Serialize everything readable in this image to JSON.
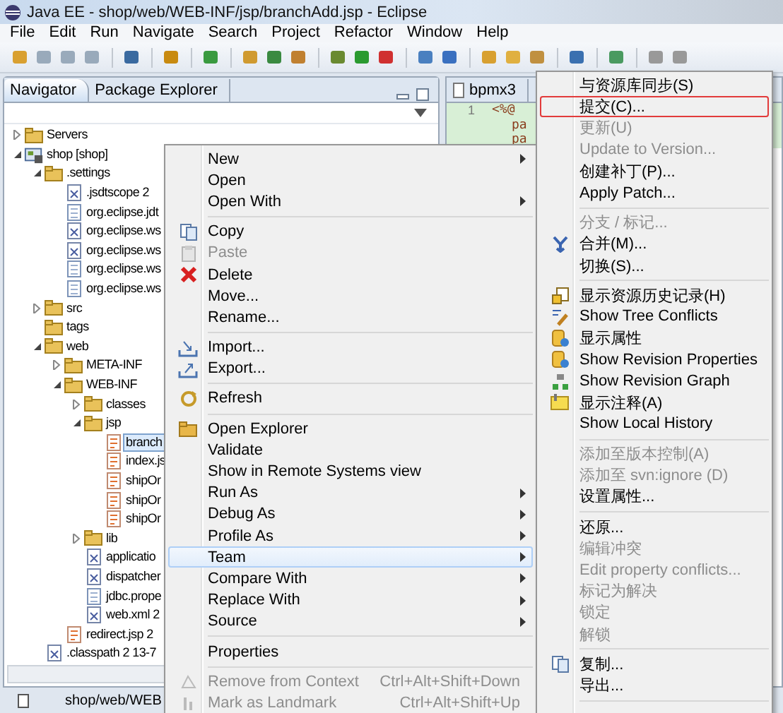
{
  "window": {
    "title": "Java EE - shop/web/WEB-INF/jsp/branchAdd.jsp - Eclipse"
  },
  "menu_bar": [
    "File",
    "Edit",
    "Run",
    "Navigate",
    "Search",
    "Project",
    "Refactor",
    "Window",
    "Help"
  ],
  "navigator": {
    "tabs": [
      {
        "label": "Navigator",
        "selected": true
      },
      {
        "label": "Package Explorer",
        "selected": false
      }
    ],
    "tree": [
      {
        "label": "Servers",
        "kind": "folder",
        "expanded": false,
        "selected": false
      },
      {
        "label": "shop [shop]",
        "kind": "project",
        "expanded": true,
        "selected": false,
        "children": [
          {
            "label": ".settings",
            "kind": "folder",
            "expanded": true,
            "selected": false,
            "children": [
              {
                "label": ".jsdtscope 2",
                "kind": "xml",
                "selected": false
              },
              {
                "label": "org.eclipse.jdt",
                "kind": "file",
                "selected": false
              },
              {
                "label": "org.eclipse.ws",
                "kind": "xml",
                "selected": false
              },
              {
                "label": "org.eclipse.ws",
                "kind": "xml",
                "selected": false
              },
              {
                "label": "org.eclipse.ws",
                "kind": "file",
                "selected": false
              },
              {
                "label": "org.eclipse.ws",
                "kind": "file",
                "selected": false
              }
            ]
          },
          {
            "label": "src",
            "kind": "folder",
            "expanded": false,
            "selected": false
          },
          {
            "label": "tags",
            "kind": "folder",
            "selected": false
          },
          {
            "label": "web",
            "kind": "folder",
            "expanded": true,
            "selected": false,
            "children": [
              {
                "label": "META-INF",
                "kind": "folder",
                "expanded": false,
                "selected": false
              },
              {
                "label": "WEB-INF",
                "kind": "folder",
                "expanded": true,
                "selected": false,
                "children": [
                  {
                    "label": "classes",
                    "kind": "folder",
                    "expanded": false,
                    "selected": false
                  },
                  {
                    "label": "jsp",
                    "kind": "folder",
                    "expanded": true,
                    "selected": false,
                    "children": [
                      {
                        "label": "branch",
                        "kind": "jsp",
                        "selected": true
                      },
                      {
                        "label": "index.js",
                        "kind": "jsp",
                        "selected": false
                      },
                      {
                        "label": "shipOr",
                        "kind": "jsp",
                        "selected": false
                      },
                      {
                        "label": "shipOr",
                        "kind": "jsp",
                        "selected": false
                      },
                      {
                        "label": "shipOr",
                        "kind": "jsp",
                        "selected": false
                      }
                    ]
                  },
                  {
                    "label": "lib",
                    "kind": "folder",
                    "expanded": false,
                    "selected": false
                  },
                  {
                    "label": "applicatio",
                    "kind": "xml",
                    "selected": false
                  },
                  {
                    "label": "dispatcher",
                    "kind": "xml",
                    "selected": false
                  },
                  {
                    "label": "jdbc.prope",
                    "kind": "file",
                    "selected": false
                  },
                  {
                    "label": "web.xml 2",
                    "kind": "xml",
                    "selected": false
                  }
                ]
              },
              {
                "label": "redirect.jsp 2",
                "kind": "jsp",
                "selected": false
              }
            ]
          },
          {
            "label": ".classpath 2  13-7",
            "kind": "xml",
            "selected": false
          }
        ]
      }
    ]
  },
  "editor": {
    "tab": "bpmx3",
    "lines": [
      {
        "number": "1",
        "text": "<%@"
      },
      {
        "text": "pa"
      },
      {
        "text": "pa"
      }
    ]
  },
  "context_menu": [
    {
      "kind": "item",
      "label": "New",
      "submenu": true
    },
    {
      "kind": "item",
      "label": "Open"
    },
    {
      "kind": "item",
      "label": "Open With",
      "submenu": true
    },
    {
      "kind": "separator"
    },
    {
      "kind": "item",
      "label": "Copy"
    },
    {
      "kind": "item",
      "label": "Paste",
      "disabled": true
    },
    {
      "kind": "item",
      "label": "Delete"
    },
    {
      "kind": "item",
      "label": "Move..."
    },
    {
      "kind": "item",
      "label": "Rename..."
    },
    {
      "kind": "separator"
    },
    {
      "kind": "item",
      "label": "Import..."
    },
    {
      "kind": "item",
      "label": "Export..."
    },
    {
      "kind": "separator"
    },
    {
      "kind": "item",
      "label": "Refresh"
    },
    {
      "kind": "separator"
    },
    {
      "kind": "item",
      "label": "Open Explorer"
    },
    {
      "kind": "item",
      "label": "Validate"
    },
    {
      "kind": "item",
      "label": "Show in Remote Systems view"
    },
    {
      "kind": "item",
      "label": "Run As",
      "submenu": true
    },
    {
      "kind": "item",
      "label": "Debug As",
      "submenu": true
    },
    {
      "kind": "item",
      "label": "Profile As",
      "submenu": true
    },
    {
      "kind": "item",
      "label": "Team",
      "submenu": true,
      "selected": true
    },
    {
      "kind": "item",
      "label": "Compare With",
      "submenu": true
    },
    {
      "kind": "item",
      "label": "Replace With",
      "submenu": true
    },
    {
      "kind": "item",
      "label": "Source",
      "submenu": true
    },
    {
      "kind": "separator"
    },
    {
      "kind": "item",
      "label": "Properties"
    },
    {
      "kind": "separator"
    },
    {
      "kind": "item",
      "label": "Remove from Context",
      "shortcut": "Ctrl+Alt+Shift+Down",
      "disabled": true
    },
    {
      "kind": "item",
      "label": "Mark as Landmark",
      "shortcut": "Ctrl+Alt+Shift+Up",
      "disabled": true
    }
  ],
  "team_submenu": [
    {
      "kind": "item",
      "label": "与资源库同步(S)"
    },
    {
      "kind": "item",
      "label": "提交(C)...",
      "selected": true
    },
    {
      "kind": "item",
      "label": "更新(U)",
      "disabled": true
    },
    {
      "kind": "item",
      "label": "Update to Version...",
      "disabled": true
    },
    {
      "kind": "item",
      "label": "创建补丁(P)..."
    },
    {
      "kind": "item",
      "label": "Apply Patch..."
    },
    {
      "kind": "separator"
    },
    {
      "kind": "item",
      "label": "分支 / 标记...",
      "disabled": true
    },
    {
      "kind": "item",
      "label": "合并(M)..."
    },
    {
      "kind": "item",
      "label": "切换(S)..."
    },
    {
      "kind": "separator"
    },
    {
      "kind": "item",
      "label": "显示资源历史记录(H)"
    },
    {
      "kind": "item",
      "label": "Show Tree Conflicts"
    },
    {
      "kind": "item",
      "label": "显示属性"
    },
    {
      "kind": "item",
      "label": "Show Revision Properties"
    },
    {
      "kind": "item",
      "label": "Show Revision Graph"
    },
    {
      "kind": "item",
      "label": "显示注释(A)"
    },
    {
      "kind": "item",
      "label": "Show Local History"
    },
    {
      "kind": "separator"
    },
    {
      "kind": "item",
      "label": "添加至版本控制(A)",
      "disabled": true
    },
    {
      "kind": "item",
      "label": "添加至 svn:ignore (D)",
      "disabled": true
    },
    {
      "kind": "item",
      "label": "设置属性..."
    },
    {
      "kind": "separator"
    },
    {
      "kind": "item",
      "label": "还原..."
    },
    {
      "kind": "item",
      "label": "编辑冲突",
      "disabled": true
    },
    {
      "kind": "item",
      "label": "Edit property conflicts...",
      "disabled": true
    },
    {
      "kind": "item",
      "label": "标记为解决",
      "disabled": true
    },
    {
      "kind": "item",
      "label": "锁定",
      "disabled": true
    },
    {
      "kind": "item",
      "label": "解锁",
      "disabled": true
    },
    {
      "kind": "separator"
    },
    {
      "kind": "item",
      "label": "复制..."
    },
    {
      "kind": "item",
      "label": "导出..."
    },
    {
      "kind": "separator"
    }
  ],
  "status_bar": {
    "path": "shop/web/WEB"
  }
}
